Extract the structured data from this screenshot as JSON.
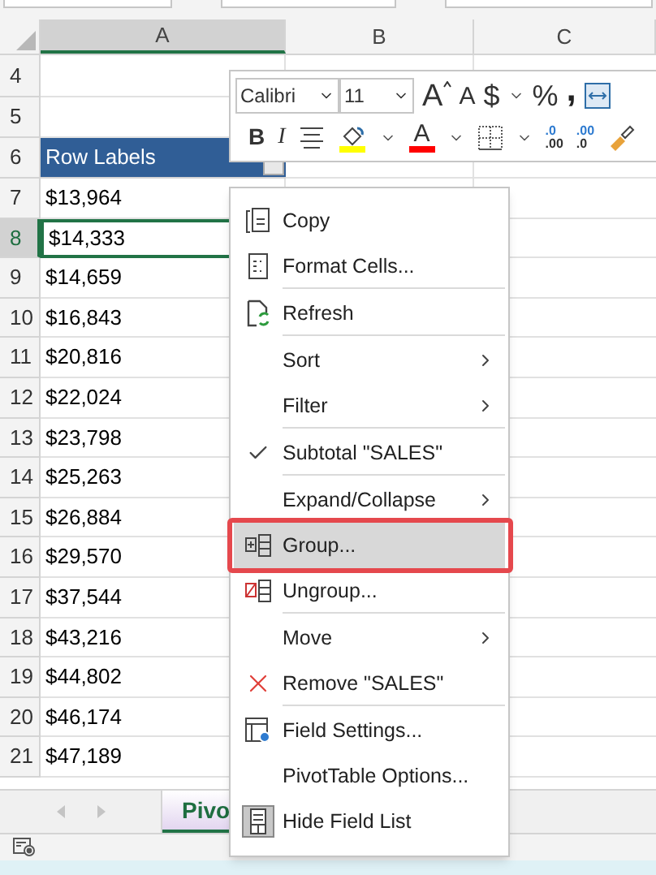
{
  "columns": [
    {
      "label": "A",
      "selected": true
    },
    {
      "label": "B",
      "selected": false
    },
    {
      "label": "C",
      "selected": false
    }
  ],
  "rows": [
    {
      "number": "4",
      "value": "",
      "kind": "tall",
      "selected": false
    },
    {
      "number": "5",
      "kind": "blank",
      "selected": false
    },
    {
      "number": "6",
      "value": "Row Labels",
      "kind": "header",
      "selected": false
    },
    {
      "number": "7",
      "value": "$13,964",
      "kind": "cell",
      "selected": false
    },
    {
      "number": "8",
      "value": "$14,333",
      "kind": "cell",
      "selected": true
    },
    {
      "number": "9",
      "value": "$14,659",
      "kind": "cell",
      "selected": false
    },
    {
      "number": "10",
      "value": "$16,843",
      "kind": "cell",
      "selected": false
    },
    {
      "number": "11",
      "value": "$20,816",
      "kind": "cell",
      "selected": false
    },
    {
      "number": "12",
      "value": "$22,024",
      "kind": "cell",
      "selected": false
    },
    {
      "number": "13",
      "value": "$23,798",
      "kind": "cell",
      "selected": false
    },
    {
      "number": "14",
      "value": "$25,263",
      "kind": "cell",
      "selected": false
    },
    {
      "number": "15",
      "value": "$26,884",
      "kind": "cell",
      "selected": false
    },
    {
      "number": "16",
      "value": "$29,570",
      "kind": "cell",
      "selected": false
    },
    {
      "number": "17",
      "value": "$37,544",
      "kind": "cell",
      "selected": false
    },
    {
      "number": "18",
      "value": "$43,216",
      "kind": "cell",
      "selected": false
    },
    {
      "number": "19",
      "value": "$44,802",
      "kind": "cell",
      "selected": false
    },
    {
      "number": "20",
      "value": "$46,174",
      "kind": "cell",
      "selected": false
    },
    {
      "number": "21",
      "value": "$47,189",
      "kind": "cell",
      "selected": false
    }
  ],
  "mini_toolbar": {
    "font": "Calibri",
    "size": "11",
    "row1": [
      {
        "kind": "grow",
        "label": "A"
      },
      {
        "kind": "shrink",
        "label": "A"
      },
      {
        "kind": "glyph",
        "label": "$"
      },
      {
        "kind": "dropdown"
      },
      {
        "kind": "glyph",
        "label": "%"
      },
      {
        "kind": "comma",
        "label": ","
      },
      {
        "kind": "wrap"
      }
    ],
    "row2": [
      {
        "kind": "bold",
        "label": "B"
      },
      {
        "kind": "italic",
        "label": "I"
      },
      {
        "kind": "center"
      },
      {
        "kind": "fill",
        "color": "#ffff00"
      },
      {
        "kind": "dropdown"
      },
      {
        "kind": "fontcolor",
        "label": "A",
        "color": "#ff0000"
      },
      {
        "kind": "dropdown"
      },
      {
        "kind": "borders"
      },
      {
        "kind": "dropdown"
      },
      {
        "kind": "decimal",
        "top": ".0",
        "bottom": ".00"
      },
      {
        "kind": "decimal",
        "top": ".00",
        "bottom": ".0"
      },
      {
        "kind": "painter"
      }
    ]
  },
  "context_menu": [
    {
      "label": "Copy",
      "submenu": false,
      "checked": false,
      "selected": false,
      "outlined": false,
      "divider_after": false
    },
    {
      "label": "Format Cells...",
      "submenu": false,
      "checked": false,
      "selected": false,
      "outlined": false,
      "divider_after": true
    },
    {
      "label": "Refresh",
      "submenu": false,
      "checked": false,
      "selected": false,
      "outlined": false,
      "divider_after": true
    },
    {
      "label": "Sort",
      "submenu": true,
      "checked": false,
      "selected": false,
      "outlined": false,
      "divider_after": false
    },
    {
      "label": "Filter",
      "submenu": true,
      "checked": false,
      "selected": false,
      "outlined": false,
      "divider_after": true
    },
    {
      "label": "Subtotal \"SALES\"",
      "submenu": false,
      "checked": true,
      "selected": false,
      "outlined": false,
      "divider_after": true
    },
    {
      "label": "Expand/Collapse",
      "submenu": true,
      "checked": false,
      "selected": false,
      "outlined": false,
      "divider_after": false
    },
    {
      "label": "Group...",
      "submenu": false,
      "checked": false,
      "selected": true,
      "outlined": true,
      "divider_after": false
    },
    {
      "label": "Ungroup...",
      "submenu": false,
      "checked": false,
      "selected": false,
      "outlined": false,
      "divider_after": true
    },
    {
      "label": "Move",
      "submenu": true,
      "checked": false,
      "selected": false,
      "outlined": false,
      "divider_after": false
    },
    {
      "label": "Remove \"SALES\"",
      "submenu": false,
      "checked": false,
      "selected": false,
      "outlined": false,
      "divider_after": true
    },
    {
      "label": "Field Settings...",
      "submenu": false,
      "checked": false,
      "selected": false,
      "outlined": false,
      "divider_after": false
    },
    {
      "label": "PivotTable Options...",
      "submenu": false,
      "checked": false,
      "selected": false,
      "outlined": false,
      "divider_after": false
    },
    {
      "label": "Hide Field List",
      "submenu": false,
      "checked": false,
      "selected": false,
      "outlined": false,
      "divider_after": false
    }
  ],
  "sheet_tab": {
    "label": "Pivo",
    "selected": true
  }
}
